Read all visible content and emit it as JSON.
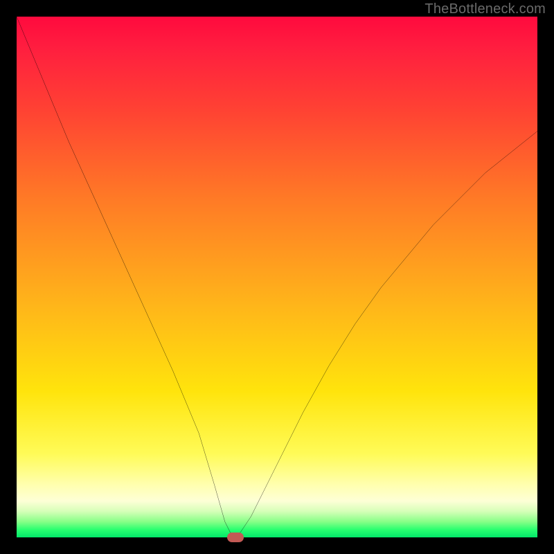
{
  "watermark": "TheBottleneck.com",
  "chart_data": {
    "type": "line",
    "title": "",
    "xlabel": "",
    "ylabel": "",
    "xlim": [
      0,
      100
    ],
    "ylim": [
      0,
      100
    ],
    "grid": false,
    "legend": false,
    "series": [
      {
        "name": "bottleneck-curve",
        "x": [
          0,
          5,
          10,
          15,
          20,
          25,
          30,
          35,
          38,
          40,
          41,
          42,
          43,
          45,
          50,
          55,
          60,
          65,
          70,
          75,
          80,
          85,
          90,
          95,
          100
        ],
        "values": [
          100,
          88,
          76,
          65,
          54,
          43,
          32,
          20,
          10,
          3,
          1,
          0,
          1,
          4,
          14,
          24,
          33,
          41,
          48,
          54,
          60,
          65,
          70,
          74,
          78
        ]
      }
    ],
    "marker": {
      "x": 42,
      "y": 0
    },
    "background_gradient": {
      "top": "#ff0a3e",
      "mid": "#ffe40c",
      "bottom": "#02e76a"
    }
  }
}
